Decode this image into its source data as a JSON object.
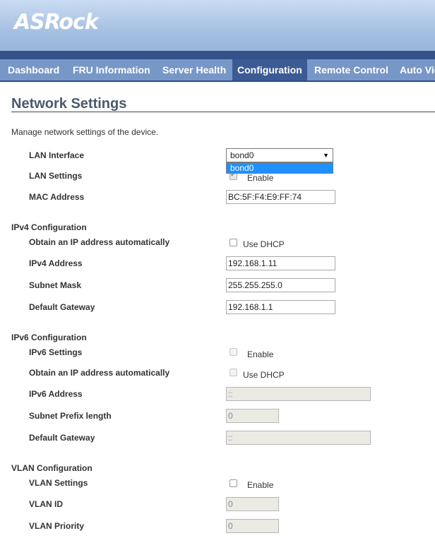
{
  "brand": {
    "logo": "ASRock"
  },
  "nav": {
    "tabs": [
      {
        "label": "Dashboard"
      },
      {
        "label": "FRU Information"
      },
      {
        "label": "Server Health"
      },
      {
        "label": "Configuration"
      },
      {
        "label": "Remote Control"
      },
      {
        "label": "Auto Video"
      }
    ],
    "active": "Configuration"
  },
  "page": {
    "title": "Network Settings",
    "description": "Manage network settings of the device."
  },
  "lan": {
    "interface_label": "LAN Interface",
    "interface_value": "bond0",
    "dropdown_options": [
      "bond0"
    ],
    "settings_label": "LAN Settings",
    "settings_checkbox_label": "Enable",
    "settings_checked": true,
    "mac_label": "MAC Address",
    "mac_value": "BC:5F:F4:E9:FF:74"
  },
  "ipv4": {
    "section": "IPv4 Configuration",
    "auto_label": "Obtain an IP address automatically",
    "dhcp_label": "Use DHCP",
    "address_label": "IPv4 Address",
    "address_value": "192.168.1.11",
    "mask_label": "Subnet Mask",
    "mask_value": "255.255.255.0",
    "gateway_label": "Default Gateway",
    "gateway_value": "192.168.1.1"
  },
  "ipv6": {
    "section": "IPv6 Configuration",
    "settings_label": "IPv6 Settings",
    "enable_label": "Enable",
    "auto_label": "Obtain an IP address automatically",
    "dhcp_label": "Use DHCP",
    "address_label": "IPv6 Address",
    "address_value": "::",
    "prefix_label": "Subnet Prefix length",
    "prefix_value": "0",
    "gateway_label": "Default Gateway",
    "gateway_value": "::"
  },
  "vlan": {
    "section": "VLAN Configuration",
    "settings_label": "VLAN Settings",
    "enable_label": "Enable",
    "id_label": "VLAN ID",
    "id_value": "0",
    "priority_label": "VLAN Priority",
    "priority_value": "0"
  }
}
